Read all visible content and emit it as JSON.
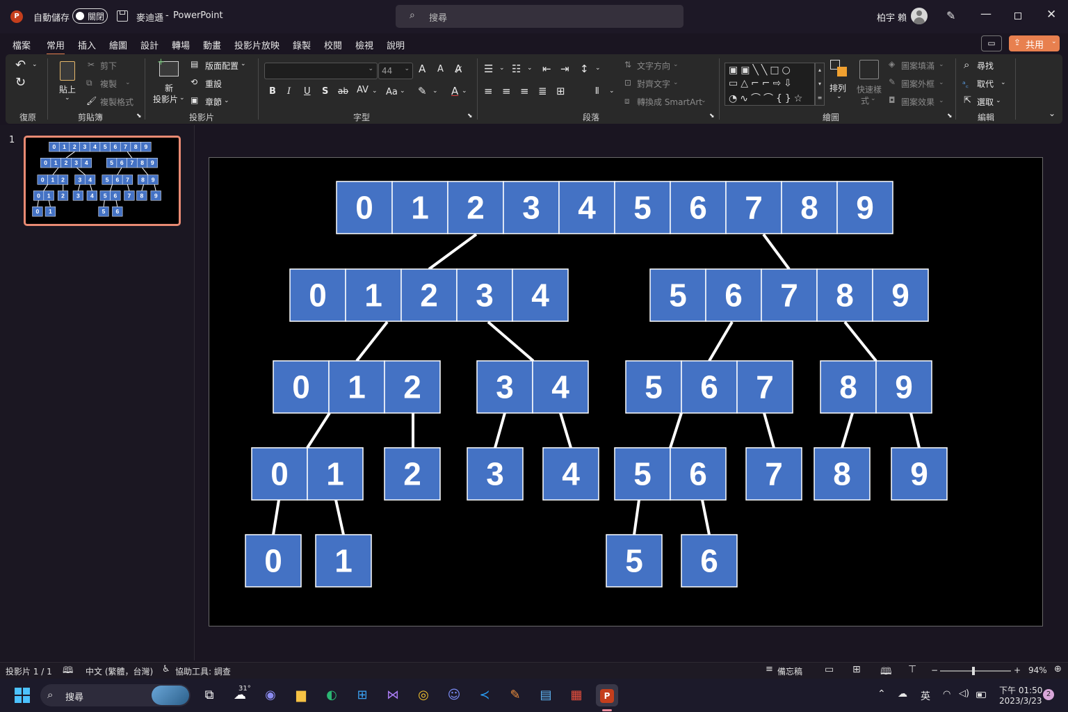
{
  "titlebar": {
    "autosave_label": "自動儲存",
    "autosave_state": "關閉",
    "file_name": "麥迪遜",
    "separator": "-",
    "app_name": "PowerPoint",
    "search_placeholder": "搜尋",
    "user_name": "柏宇 賴"
  },
  "menu": {
    "items": [
      "檔案",
      "常用",
      "插入",
      "繪圖",
      "設計",
      "轉場",
      "動畫",
      "投影片放映",
      "錄製",
      "校閱",
      "檢視",
      "說明"
    ],
    "active": "常用",
    "share_label": "共用"
  },
  "ribbon": {
    "undo_group": "復原",
    "clipboard": {
      "paste": "貼上",
      "cut": "剪下",
      "copy": "複製",
      "format_painter": "複製格式",
      "group": "剪貼簿"
    },
    "slides": {
      "new_slide_1": "新",
      "new_slide_2": "投影片",
      "layout": "版面配置",
      "reset": "重設",
      "section": "章節",
      "group": "投影片"
    },
    "font": {
      "font_size": "44",
      "group": "字型",
      "bold": "B",
      "italic": "I",
      "underline": "U",
      "shadow": "S",
      "strike": "ab",
      "spacing": "AV",
      "case": "Aa",
      "grow": "A",
      "shrink": "A"
    },
    "paragraph": {
      "text_direction": "文字方向",
      "align_text": "對齊文字",
      "smartart": "轉換成 SmartArt",
      "group": "段落"
    },
    "drawing": {
      "arrange": "排列",
      "quick_styles_1": "快速樣",
      "quick_styles_2": "式",
      "shape_fill": "圖案填滿",
      "shape_outline": "圖案外框",
      "shape_effects": "圖案效果",
      "group": "繪圖"
    },
    "editing": {
      "find": "尋找",
      "replace": "取代",
      "select": "選取",
      "group": "編輯"
    }
  },
  "slide_panel": {
    "slide_number": "1"
  },
  "tree": {
    "boxes": [
      {
        "id": "L0",
        "digits": [
          "0",
          "1",
          "2",
          "3",
          "4",
          "5",
          "6",
          "7",
          "8",
          "9"
        ]
      },
      {
        "id": "L1a",
        "digits": [
          "0",
          "1",
          "2",
          "3",
          "4"
        ]
      },
      {
        "id": "L1b",
        "digits": [
          "5",
          "6",
          "7",
          "8",
          "9"
        ]
      },
      {
        "id": "L2a",
        "digits": [
          "0",
          "1",
          "2"
        ]
      },
      {
        "id": "L2b",
        "digits": [
          "3",
          "4"
        ]
      },
      {
        "id": "L2c",
        "digits": [
          "5",
          "6",
          "7"
        ]
      },
      {
        "id": "L2d",
        "digits": [
          "8",
          "9"
        ]
      },
      {
        "id": "L3a",
        "digits": [
          "0",
          "1"
        ]
      },
      {
        "id": "L3b",
        "digits": [
          "2"
        ]
      },
      {
        "id": "L3c",
        "digits": [
          "3"
        ]
      },
      {
        "id": "L3d",
        "digits": [
          "4"
        ]
      },
      {
        "id": "L3e",
        "digits": [
          "5",
          "6"
        ]
      },
      {
        "id": "L3f",
        "digits": [
          "7"
        ]
      },
      {
        "id": "L3g",
        "digits": [
          "8"
        ]
      },
      {
        "id": "L3h",
        "digits": [
          "9"
        ]
      },
      {
        "id": "L4a",
        "digits": [
          "0"
        ]
      },
      {
        "id": "L4b",
        "digits": [
          "1"
        ]
      },
      {
        "id": "L4c",
        "digits": [
          "5"
        ]
      },
      {
        "id": "L4d",
        "digits": [
          "6"
        ]
      }
    ],
    "cell_color": "#4472c4"
  },
  "statusbar": {
    "slide_info": "投影片 1 / 1",
    "language": "中文 (繁體，台灣)",
    "accessibility": "協助工具: 調查",
    "notes": "備忘稿",
    "zoom_minus": "−",
    "zoom_plus": "+",
    "zoom": "94%"
  },
  "taskbar": {
    "search": "搜尋",
    "weather": "31°",
    "ime": "英",
    "time": "下午 01:50",
    "date": "2023/3/23",
    "notification_count": "2"
  },
  "colors": {
    "accent": "#e8804f",
    "slide_cell": "#4472c4",
    "ppt_red": "#c43e1c"
  }
}
